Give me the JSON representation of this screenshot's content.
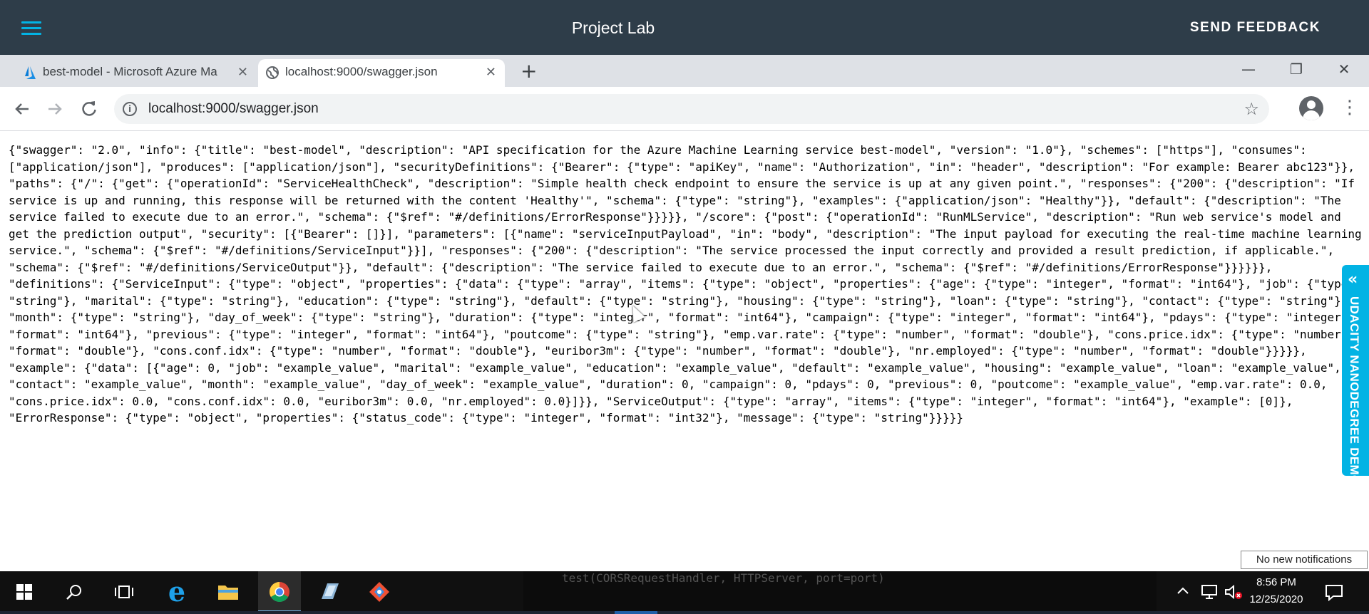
{
  "appbar": {
    "title": "Project Lab",
    "feedback_label": "SEND FEEDBACK"
  },
  "browser": {
    "tabs": [
      {
        "label": "best-model - Microsoft Azure Ma",
        "close": "✕"
      },
      {
        "label": "localhost:9000/swagger.json",
        "close": "✕"
      }
    ],
    "new_tab": "+",
    "url": "localhost:9000/swagger.json",
    "window_controls": {
      "minimize": "—",
      "restore": "❐",
      "close": "✕"
    }
  },
  "page": {
    "json_text": "{\"swagger\": \"2.0\", \"info\": {\"title\": \"best-model\", \"description\": \"API specification for the Azure Machine Learning service best-model\", \"version\": \"1.0\"}, \"schemes\": [\"https\"], \"consumes\": [\"application/json\"], \"produces\": [\"application/json\"], \"securityDefinitions\": {\"Bearer\": {\"type\": \"apiKey\", \"name\": \"Authorization\", \"in\": \"header\", \"description\": \"For example: Bearer abc123\"}}, \"paths\": {\"/\": {\"get\": {\"operationId\": \"ServiceHealthCheck\", \"description\": \"Simple health check endpoint to ensure the service is up at any given point.\", \"responses\": {\"200\": {\"description\": \"If service is up and running, this response will be returned with the content 'Healthy'\", \"schema\": {\"type\": \"string\"}, \"examples\": {\"application/json\": \"Healthy\"}}, \"default\": {\"description\": \"The service failed to execute due to an error.\", \"schema\": {\"$ref\": \"#/definitions/ErrorResponse\"}}}}}, \"/score\": {\"post\": {\"operationId\": \"RunMLService\", \"description\": \"Run web service's model and get the prediction output\", \"security\": [{\"Bearer\": []}], \"parameters\": [{\"name\": \"serviceInputPayload\", \"in\": \"body\", \"description\": \"The input payload for executing the real-time machine learning service.\", \"schema\": {\"$ref\": \"#/definitions/ServiceInput\"}}], \"responses\": {\"200\": {\"description\": \"The service processed the input correctly and provided a result prediction, if applicable.\", \"schema\": {\"$ref\": \"#/definitions/ServiceOutput\"}}, \"default\": {\"description\": \"The service failed to execute due to an error.\", \"schema\": {\"$ref\": \"#/definitions/ErrorResponse\"}}}}}}, \"definitions\": {\"ServiceInput\": {\"type\": \"object\", \"properties\": {\"data\": {\"type\": \"array\", \"items\": {\"type\": \"object\", \"properties\": {\"age\": {\"type\": \"integer\", \"format\": \"int64\"}, \"job\": {\"type\": \"string\"}, \"marital\": {\"type\": \"string\"}, \"education\": {\"type\": \"string\"}, \"default\": {\"type\": \"string\"}, \"housing\": {\"type\": \"string\"}, \"loan\": {\"type\": \"string\"}, \"contact\": {\"type\": \"string\"}, \"month\": {\"type\": \"string\"}, \"day_of_week\": {\"type\": \"string\"}, \"duration\": {\"type\": \"integer\", \"format\": \"int64\"}, \"campaign\": {\"type\": \"integer\", \"format\": \"int64\"}, \"pdays\": {\"type\": \"integer\", \"format\": \"int64\"}, \"previous\": {\"type\": \"integer\", \"format\": \"int64\"}, \"poutcome\": {\"type\": \"string\"}, \"emp.var.rate\": {\"type\": \"number\", \"format\": \"double\"}, \"cons.price.idx\": {\"type\": \"number\", \"format\": \"double\"}, \"cons.conf.idx\": {\"type\": \"number\", \"format\": \"double\"}, \"euribor3m\": {\"type\": \"number\", \"format\": \"double\"}, \"nr.employed\": {\"type\": \"number\", \"format\": \"double\"}}}}}, \"example\": {\"data\": [{\"age\": 0, \"job\": \"example_value\", \"marital\": \"example_value\", \"education\": \"example_value\", \"default\": \"example_value\", \"housing\": \"example_value\", \"loan\": \"example_value\", \"contact\": \"example_value\", \"month\": \"example_value\", \"day_of_week\": \"example_value\", \"duration\": 0, \"campaign\": 0, \"pdays\": 0, \"previous\": 0, \"poutcome\": \"example_value\", \"emp.var.rate\": 0.0, \"cons.price.idx\": 0.0, \"cons.conf.idx\": 0.0, \"euribor3m\": 0.0, \"nr.employed\": 0.0}]}}, \"ServiceOutput\": {\"type\": \"array\", \"items\": {\"type\": \"integer\", \"format\": \"int64\"}, \"example\": [0]}, \"ErrorResponse\": {\"type\": \"object\", \"properties\": {\"status_code\": {\"type\": \"integer\", \"format\": \"int32\"}, \"message\": {\"type\": \"string\"}}}}}"
  },
  "side_tab": {
    "label": "UDACITY NANODEGREE DEMO",
    "color": "#02b3e4"
  },
  "notification": {
    "text": "No new notifications"
  },
  "taskbar": {
    "terminal_text": "test(CORSRequestHandler, HTTPServer, port=port)",
    "time": "8:56 PM",
    "date": "12/25/2020"
  },
  "icons": [
    "hamburger-menu-icon",
    "azure-icon",
    "globe-icon",
    "back-arrow-icon",
    "forward-arrow-icon",
    "reload-icon",
    "info-icon",
    "star-icon",
    "profile-icon",
    "kebab-menu-icon",
    "windows-start-icon",
    "search-icon",
    "task-view-icon",
    "ie-icon",
    "file-explorer-icon",
    "chrome-icon",
    "app-icon",
    "git-icon",
    "chevron-up-icon",
    "network-icon",
    "volume-muted-icon",
    "action-center-icon"
  ],
  "colors": {
    "appbar_bg": "#2e3d49",
    "accent": "#02b3e4",
    "tabstrip_bg": "#dee1e6",
    "taskbar_bg": "#101010"
  }
}
